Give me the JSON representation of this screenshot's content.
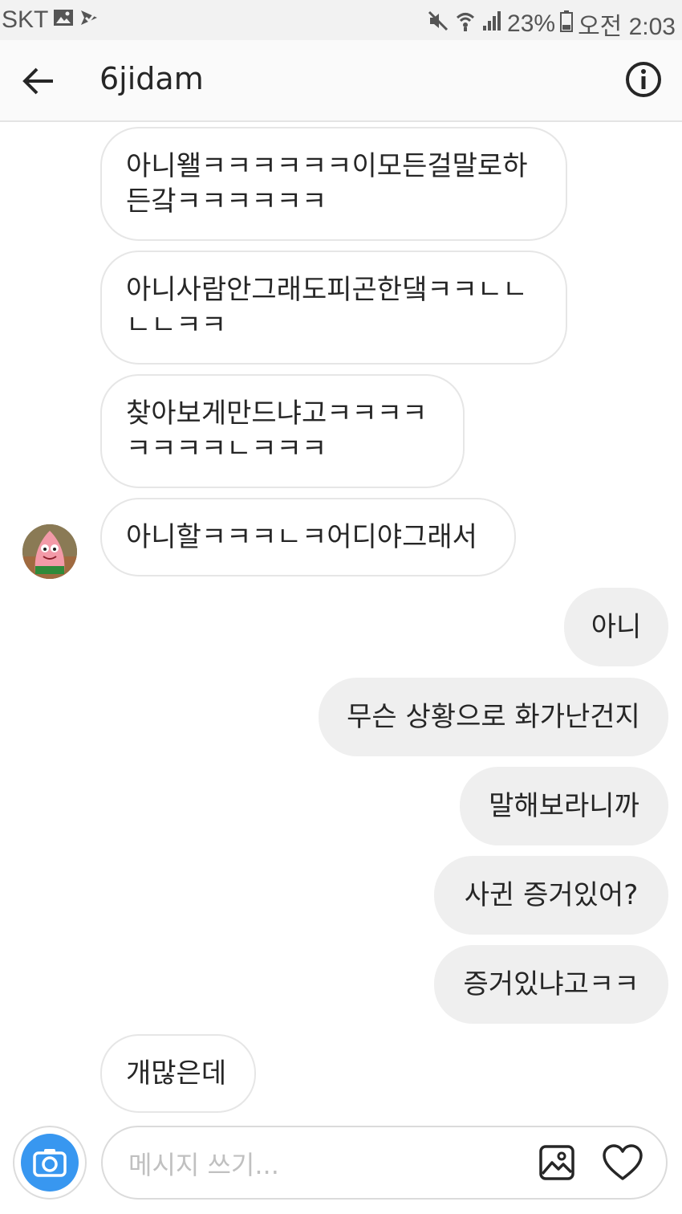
{
  "status_bar": {
    "carrier": "SKT",
    "battery": "23%",
    "time": "오전 2:03"
  },
  "header": {
    "title": "6jidam"
  },
  "messages": [
    {
      "side": "in",
      "text": "아니왤ㅋㅋㅋㅋㅋㅋ이모든걸말로하든갘ㅋㅋㅋㅋㅋㅋ"
    },
    {
      "side": "in",
      "text": "아니사람안그래도피곤한댘ㅋㅋㄴㄴㄴㄴㅋㅋ"
    },
    {
      "side": "in",
      "text": "찾아보게만드냐고ㅋㅋㅋㅋㅋㅋㅋㅋㄴㅋㅋㅋ"
    },
    {
      "side": "in",
      "text": "아니할ㅋㅋㅋㄴㅋ어디야그래서"
    },
    {
      "side": "out",
      "text": "아니"
    },
    {
      "side": "out",
      "text": "무슨 상황으로 화가난건지"
    },
    {
      "side": "out",
      "text": "말해보라니까"
    },
    {
      "side": "out",
      "text": "사귄 증거있어?"
    },
    {
      "side": "out",
      "text": "증거있냐고ㅋㅋ"
    },
    {
      "side": "in",
      "text": "개많은데"
    }
  ],
  "composer": {
    "placeholder": "메시지 쓰기..."
  },
  "colors": {
    "accent": "#3897f0",
    "outgoing_bubble": "#efefef",
    "incoming_border": "#e6e6e6"
  },
  "icons": {
    "back": "arrow-left-icon",
    "info": "info-icon",
    "camera": "camera-icon",
    "gallery": "image-icon",
    "like": "heart-icon"
  }
}
